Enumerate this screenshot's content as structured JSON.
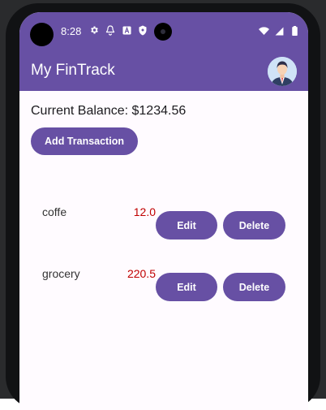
{
  "status_bar": {
    "time": "8:28",
    "left_icons": [
      "settings-icon",
      "accessibility-icon",
      "a-icon",
      "shield-icon"
    ],
    "right_icons": [
      "wifi-icon",
      "signal-icon",
      "battery-icon"
    ]
  },
  "app_bar": {
    "title": "My FinTrack",
    "avatar": "avatar-icon"
  },
  "balance": {
    "label": "Current Balance: $1234.56"
  },
  "actions": {
    "add_label": "Add Transaction"
  },
  "transactions": [
    {
      "name": "coffe",
      "amount": "12.0",
      "edit_label": "Edit",
      "delete_label": "Delete"
    },
    {
      "name": "grocery",
      "amount": "220.5",
      "edit_label": "Edit",
      "delete_label": "Delete"
    }
  ],
  "colors": {
    "primary": "#6750a4",
    "amount": "#c00000",
    "background": "#fffbff"
  }
}
